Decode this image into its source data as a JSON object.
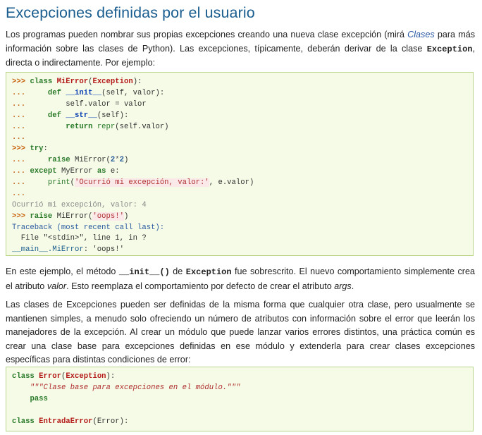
{
  "title": "Excepciones definidas por el usuario",
  "intro": {
    "t1": "Los programas pueden nombrar sus propias excepciones creando una nueva clase excepción (mirá ",
    "link": "Clases",
    "t2": " para más información sobre las clases de Python). Las excepciones, típicamente, deberán derivar de la clase ",
    "code": "Exception",
    "t3": ", directa o indirectamente. Por ejemplo:"
  },
  "code1": {
    "l1": {
      "p": ">>>",
      "kw": "class",
      "cls": "MiError",
      "base": "Exception"
    },
    "l2": {
      "p": "...",
      "kw": "def",
      "fn": "__init__",
      "args": "(self, valor):"
    },
    "l3": {
      "p": "...",
      "text": "self.valor = valor"
    },
    "l4": {
      "p": "...",
      "kw": "def",
      "fn": "__str__",
      "args": "(self):"
    },
    "l5": {
      "p": "...",
      "kw": "return",
      "bi": "repr",
      "rest": "(self.valor)"
    },
    "l6": {
      "p": "..."
    },
    "l7": {
      "p": ">>>",
      "kw": "try",
      "rest": ":"
    },
    "l8": {
      "p": "...",
      "kw": "raise",
      "name": "MiError(",
      "num1": "2",
      "op": "*",
      "num2": "2",
      "end": ")"
    },
    "l9": {
      "p": "...",
      "kw": "except",
      "name": "MyError",
      "kw2": "as",
      "rest": "e:"
    },
    "l10": {
      "p": "...",
      "bi": "print",
      "str": "'Ocurrió mi excepción, valor:'",
      "rest": ", e.valor)"
    },
    "l11": {
      "p": "..."
    },
    "l12": {
      "out": "Ocurrió mi excepción, valor: 4"
    },
    "l13": {
      "p": ">>>",
      "kw": "raise",
      "name": "MiError(",
      "str": "'oops!'",
      "end": ")"
    },
    "l14": {
      "tb": "Traceback (most recent call last):"
    },
    "l15": {
      "text": "  File \"<stdin>\", line 1, in ?"
    },
    "l16": {
      "nl": "__main__.MiError",
      "rest": ": 'oops!'"
    }
  },
  "para2": {
    "t1": "En este ejemplo, el método ",
    "code1": "__init__()",
    "t2": " de ",
    "code2": "Exception",
    "t3": " fue sobrescrito. El nuevo comportamiento simplemente crea el atributo ",
    "em1": "valor",
    "t4": ". Esto reemplaza el comportamiento por defecto de crear el atributo ",
    "em2": "args",
    "t5": "."
  },
  "para3": "Las clases de Excepciones pueden ser definidas de la misma forma que cualquier otra clase, pero usualmente se mantienen simples, a menudo solo ofreciendo un número de atributos con información sobre el error que leerán los manejadores de la excepción. Al crear un módulo que puede lanzar varios errores distintos, una práctica común es crear una clase base para excepciones definidas en ese módulo y extenderla para crear clases excepciones específicas para distintas condiciones de error:",
  "code2": {
    "l1": {
      "kw": "class",
      "cls": "Error",
      "base": "Exception"
    },
    "l2": {
      "doc": "\"\"\"Clase base para excepciones en el módulo.\"\"\""
    },
    "l3": {
      "kw": "pass"
    },
    "l5": {
      "kw": "class",
      "cls": "EntradaError",
      "base": "Error"
    }
  }
}
